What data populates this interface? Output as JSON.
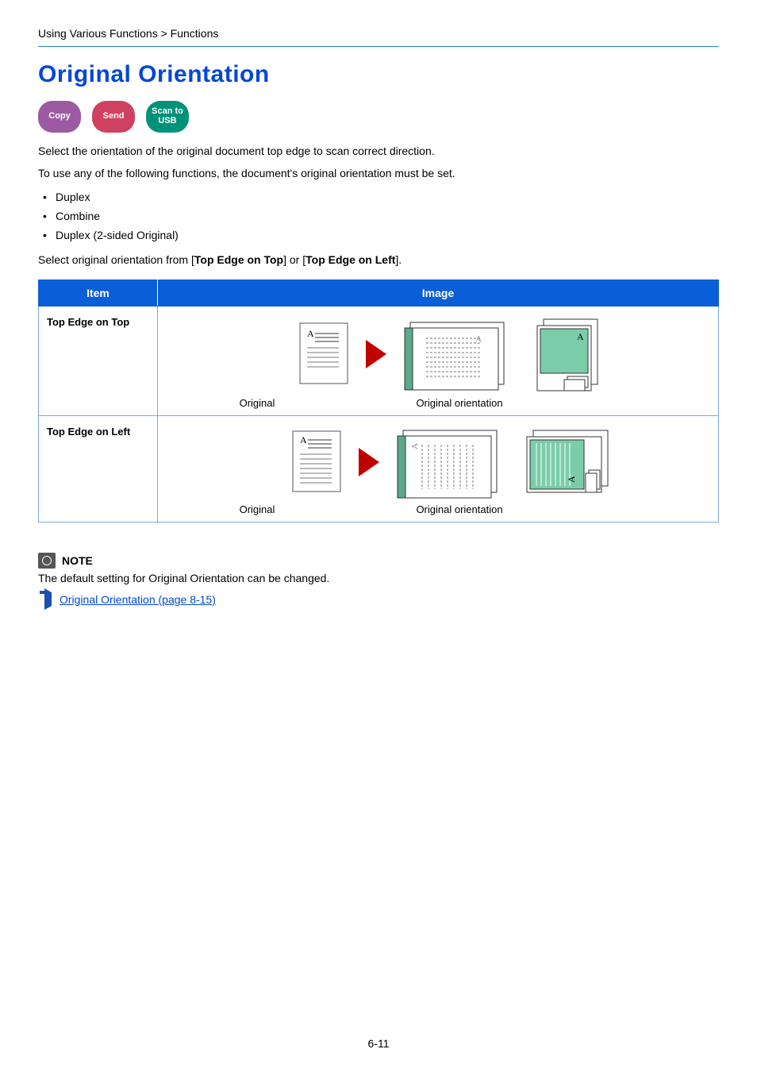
{
  "breadcrumb": "Using Various Functions > Functions",
  "title": "Original Orientation",
  "badges": {
    "copy": "Copy",
    "send": "Send",
    "scan": "Scan to\nUSB"
  },
  "intro1": "Select the orientation of the original document top edge to scan correct direction.",
  "intro2": "To use any of the following functions, the document's original orientation must be set.",
  "bullets": [
    "Duplex",
    "Combine",
    "Duplex (2-sided Original)"
  ],
  "select_line_prefix": "Select original orientation from [",
  "select_opt1": "Top Edge on Top",
  "select_mid": "] or [",
  "select_opt2": "Top Edge on Left",
  "select_suffix": "].",
  "table": {
    "header_item": "Item",
    "header_image": "Image",
    "row1_item": "Top Edge on Top",
    "row2_item": "Top Edge on Left",
    "caption_original": "Original",
    "caption_orientation": "Original orientation"
  },
  "note": {
    "label": "NOTE",
    "text": "The default setting for Original Orientation can be changed.",
    "link": "Original Orientation (page 8-15)"
  },
  "page_number": "6-11"
}
